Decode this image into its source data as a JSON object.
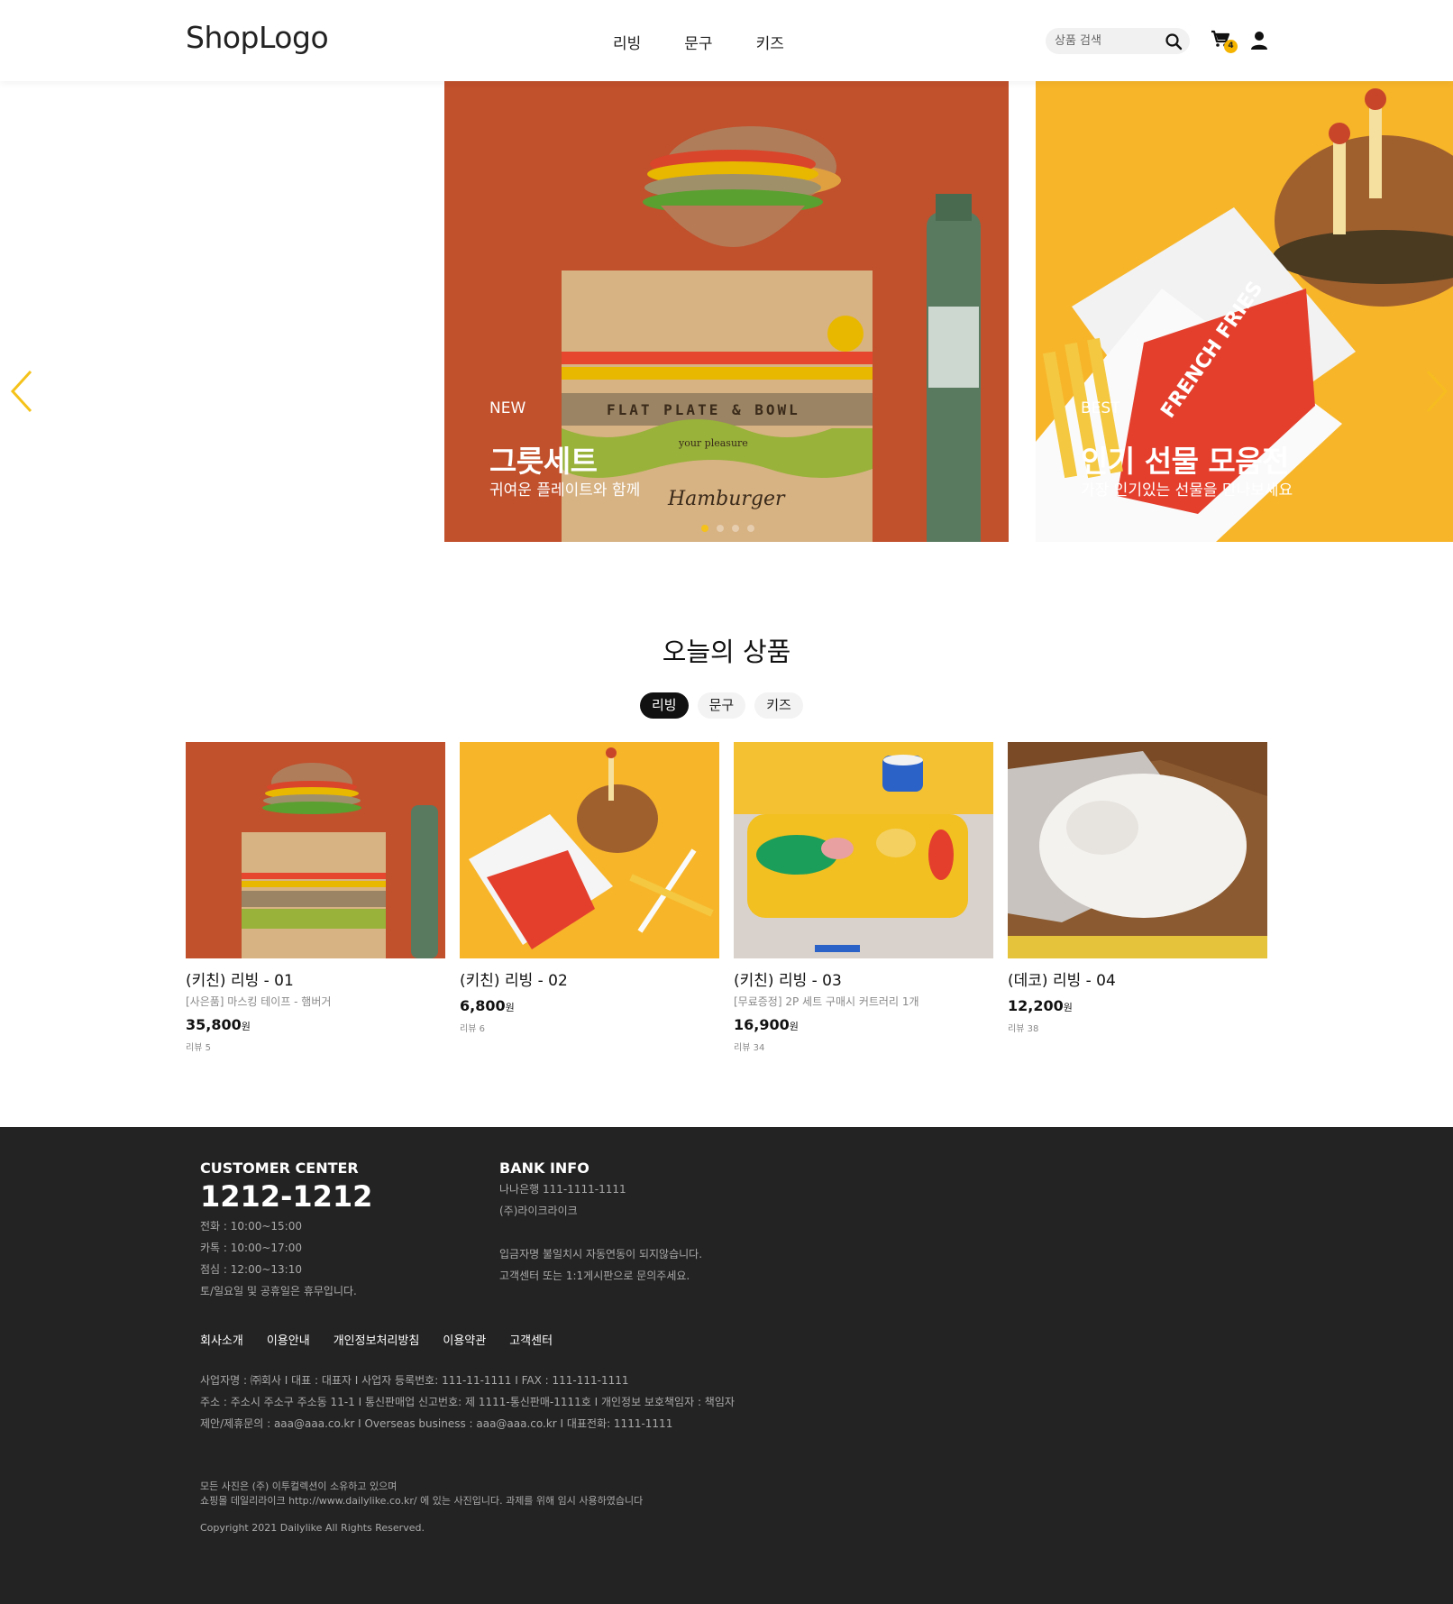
{
  "header": {
    "logo": "ShopLogo",
    "nav": [
      "리빙",
      "문구",
      "키즈"
    ],
    "search_placeholder": "상품 검색",
    "cart_count": "4"
  },
  "hero": {
    "slides": [
      {
        "tag": "NEW",
        "title": "그릇세트",
        "subtitle": "귀여운 플레이트와 함께",
        "box_text": "FLAT PLATE & BOWL",
        "box_sub": "your pleasure",
        "box_script": "Hamburger"
      },
      {
        "tag": "BEST",
        "title": "인기 선물 모음전",
        "subtitle": "가장 인기있는 선물을 만나보세요",
        "box_text": "FRENCH FRIES"
      }
    ],
    "active_dot": 0
  },
  "section": {
    "title": "오늘의 상품",
    "tabs": [
      "리빙",
      "문구",
      "키즈"
    ]
  },
  "products": [
    {
      "name": "(키친) 리빙 - 01",
      "desc": "[사은품] 마스킹 테이프 - 햄버거",
      "price": "35,800",
      "unit": "원",
      "review": "리뷰 5"
    },
    {
      "name": "(키친) 리빙 - 02",
      "desc": "",
      "price": "6,800",
      "unit": "원",
      "review": "리뷰 6"
    },
    {
      "name": "(키친) 리빙 - 03",
      "desc": "[무료증정] 2P 세트 구매시 커트러리 1개",
      "price": "16,900",
      "unit": "원",
      "review": "리뷰 34"
    },
    {
      "name": "(데코) 리빙 - 04",
      "desc": "",
      "price": "12,200",
      "unit": "원",
      "review": "리뷰 38"
    }
  ],
  "footer": {
    "cc_title": "CUSTOMER CENTER",
    "phone": "1212-1212",
    "cc_lines": [
      "전화 : 10:00~15:00",
      "카톡 : 10:00~17:00",
      "점심 : 12:00~13:10",
      "토/일요일 및 공휴일은 휴무입니다."
    ],
    "bank_title": "BANK INFO",
    "bank_lines": [
      "나나은행 111-1111-1111",
      "(주)라이크라이크",
      "",
      "입금자명 불일치시 자동연동이 되지않습니다.",
      "고객센터 또는 1:1게시판으로 문의주세요."
    ],
    "links": [
      "회사소개",
      "이용안내",
      "개인정보처리방침",
      "이용약관",
      "고객센터"
    ],
    "biz_lines": [
      "사업자명 : ㈜회사   I   대표 : 대표자   I   사업자 등록번호: 111-11-1111   I   FAX : 111-111-1111",
      "주소 : 주소시 주소구 주소동 11-1   I   통신판매업 신고번호: 제 1111-통신판매-1111호   I   개인정보 보호책임자 : 책임자",
      "제안/제휴문의 : aaa@aaa.co.kr   I   Overseas business : aaa@aaa.co.kr   I   대표전화: 1111-1111"
    ],
    "notice_lines": [
      "모든 사진은 (주) 이투컬렉션이 소유하고 있으며",
      "쇼핑몰 데일리라이크 http://www.dailylike.co.kr/ 에 있는 사진입니다. 과제를 위해 임시 사용하였습니다"
    ],
    "copyright": "Copyright 2021 Dailylike All Rights Reserved."
  },
  "colors": {
    "accent": "#f5c21a",
    "footer_bg": "#232323",
    "slide1_bg": "#c1502c",
    "slide2_bg": "#f7b52a"
  }
}
